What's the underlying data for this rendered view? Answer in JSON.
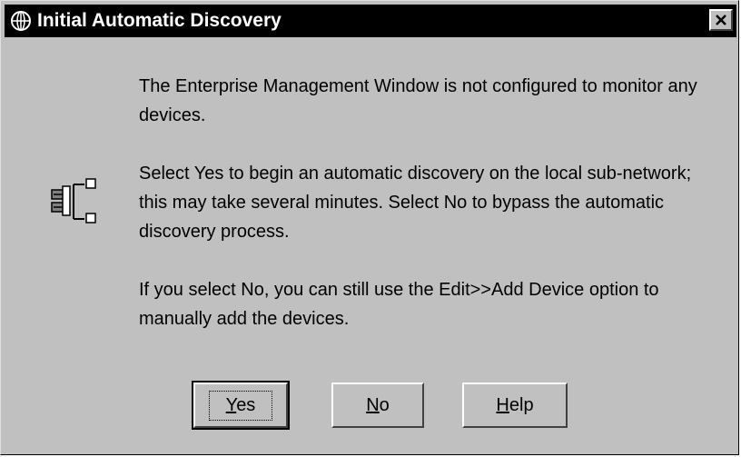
{
  "dialog": {
    "title": "Initial Automatic Discovery",
    "title_icon": "globe-icon",
    "close_icon": "close-icon",
    "message_icon": "network-tree-icon",
    "paragraphs": [
      "The Enterprise Management Window is not configured to monitor any devices.",
      "Select Yes to begin an automatic discovery on the local sub-network; this may take several minutes. Select No to bypass the automatic discovery process.",
      "If you select No, you can still use the Edit>>Add Device option to manually add the devices."
    ],
    "buttons": {
      "yes": {
        "mnemonic": "Y",
        "rest": "es"
      },
      "no": {
        "mnemonic": "N",
        "rest": "o"
      },
      "help": {
        "mnemonic": "H",
        "rest": "elp"
      }
    }
  },
  "colors": {
    "face": "#c0c0c0",
    "titlebar": "#000000",
    "title_text": "#ffffff"
  }
}
